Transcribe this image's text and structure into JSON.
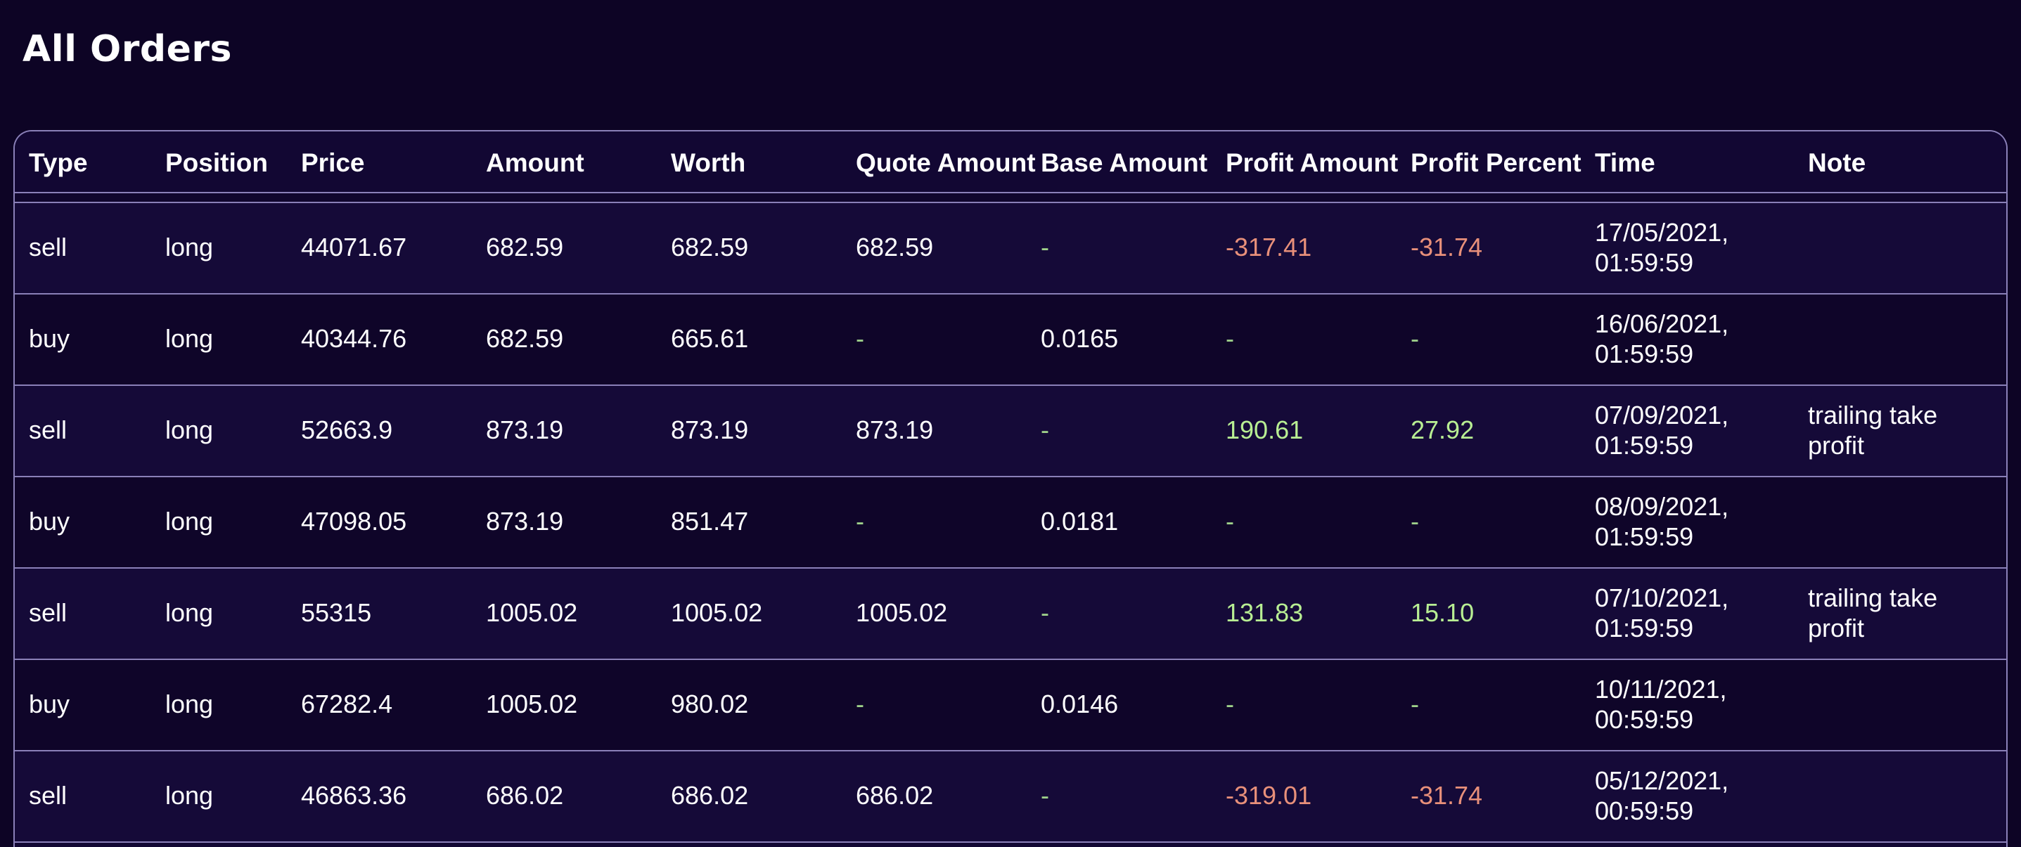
{
  "page": {
    "title": "All Orders"
  },
  "table": {
    "headers": [
      "Type",
      "Position",
      "Price",
      "Amount",
      "Worth",
      "Quote Amount",
      "Base Amount",
      "Profit Amount",
      "Profit Percent",
      "Time",
      "Note"
    ],
    "rows": [
      {
        "type": "sell",
        "position": "long",
        "price": "44071.67",
        "amount": "682.59",
        "worth": "682.59",
        "quote_amount": "682.59",
        "base_amount": "-",
        "profit_amount": "-317.41",
        "profit_percent": "-31.74",
        "time_date": "17/05/2021,",
        "time_clock": "01:59:59",
        "note_line1": "",
        "note_line2": ""
      },
      {
        "type": "buy",
        "position": "long",
        "price": "40344.76",
        "amount": "682.59",
        "worth": "665.61",
        "quote_amount": "-",
        "base_amount": "0.0165",
        "profit_amount": "-",
        "profit_percent": "-",
        "time_date": "16/06/2021,",
        "time_clock": "01:59:59",
        "note_line1": "",
        "note_line2": ""
      },
      {
        "type": "sell",
        "position": "long",
        "price": "52663.9",
        "amount": "873.19",
        "worth": "873.19",
        "quote_amount": "873.19",
        "base_amount": "-",
        "profit_amount": "190.61",
        "profit_percent": "27.92",
        "time_date": "07/09/2021,",
        "time_clock": "01:59:59",
        "note_line1": "trailing take",
        "note_line2": "profit"
      },
      {
        "type": "buy",
        "position": "long",
        "price": "47098.05",
        "amount": "873.19",
        "worth": "851.47",
        "quote_amount": "-",
        "base_amount": "0.0181",
        "profit_amount": "-",
        "profit_percent": "-",
        "time_date": "08/09/2021,",
        "time_clock": "01:59:59",
        "note_line1": "",
        "note_line2": ""
      },
      {
        "type": "sell",
        "position": "long",
        "price": "55315",
        "amount": "1005.02",
        "worth": "1005.02",
        "quote_amount": "1005.02",
        "base_amount": "-",
        "profit_amount": "131.83",
        "profit_percent": "15.10",
        "time_date": "07/10/2021,",
        "time_clock": "01:59:59",
        "note_line1": "trailing take",
        "note_line2": "profit"
      },
      {
        "type": "buy",
        "position": "long",
        "price": "67282.4",
        "amount": "1005.02",
        "worth": "980.02",
        "quote_amount": "-",
        "base_amount": "0.0146",
        "profit_amount": "-",
        "profit_percent": "-",
        "time_date": "10/11/2021,",
        "time_clock": "00:59:59",
        "note_line1": "",
        "note_line2": ""
      },
      {
        "type": "sell",
        "position": "long",
        "price": "46863.36",
        "amount": "686.02",
        "worth": "686.02",
        "quote_amount": "686.02",
        "base_amount": "-",
        "profit_amount": "-319.01",
        "profit_percent": "-31.74",
        "time_date": "05/12/2021,",
        "time_clock": "00:59:59",
        "note_line1": "",
        "note_line2": ""
      }
    ]
  },
  "colors": {
    "background": "#0d0425",
    "table_background": "#120733",
    "border": "#8a80b8",
    "negative": "#e8907a",
    "positive": "#b8ee93",
    "dash": "#9fd18a"
  }
}
